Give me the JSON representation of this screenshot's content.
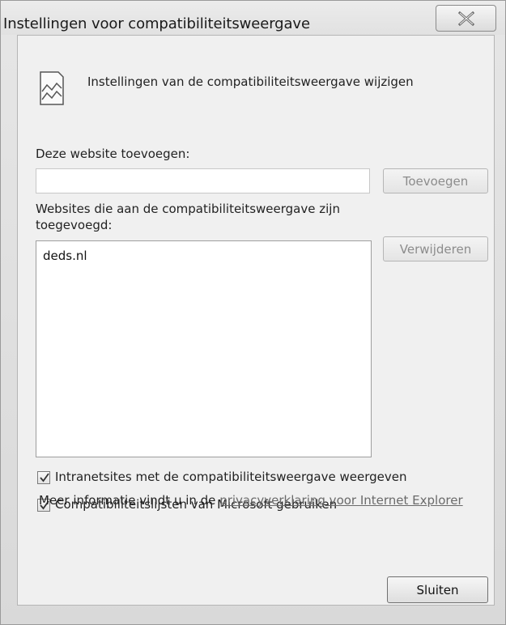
{
  "window": {
    "title": "Instellingen voor compatibiliteitsweergave"
  },
  "header": {
    "icon": "compatibility-view-icon",
    "text": "Instellingen van de compatibiliteitsweergave wijzigen"
  },
  "add_section": {
    "label": "Deze website toevoegen:",
    "input_value": "",
    "add_button_label": "Toevoegen"
  },
  "list_section": {
    "label_line1": "Websites die aan de compatibiliteitsweergave zijn",
    "label_line2": "toegevoegd:",
    "items": [
      "deds.nl"
    ],
    "remove_button_label": "Verwijderen"
  },
  "options": {
    "intranet": {
      "label": "Intranetsites met de compatibiliteitsweergave weergeven",
      "checked": true
    },
    "microsoft_lists": {
      "label": "Compatibiliteitslijsten van Microsoft gebruiken",
      "checked": true
    }
  },
  "info": {
    "prefix": "Meer informatie vindt u in de ",
    "link_text": "privacyverklaring voor Internet Explorer"
  },
  "footer": {
    "close_button_label": "Sluiten"
  }
}
